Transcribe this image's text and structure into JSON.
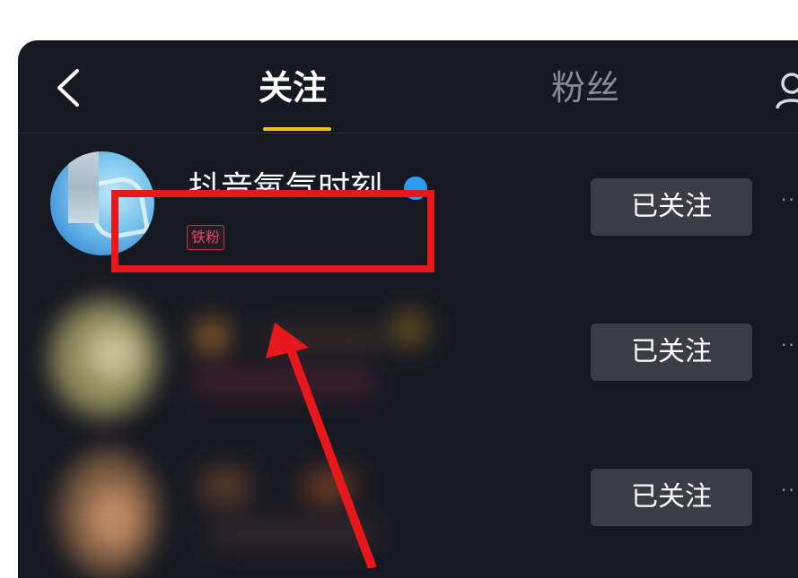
{
  "header": {
    "back_icon": "chevron-left-icon",
    "tabs": [
      {
        "label": "关注",
        "active": true
      },
      {
        "label": "粉丝",
        "active": false
      }
    ],
    "profile_icon": "person-icon",
    "underline_color": "#f5c219"
  },
  "list": [
    {
      "username": "抖音氧气时刻",
      "badge": "铁粉",
      "button": "已关注",
      "verified": true
    },
    {
      "username": "",
      "badge": "",
      "button": "已关注"
    },
    {
      "username": "",
      "badge": "",
      "button": "已关注"
    }
  ],
  "annotation": {
    "box_color": "#e6181c",
    "arrow_color": "#e6181c"
  }
}
